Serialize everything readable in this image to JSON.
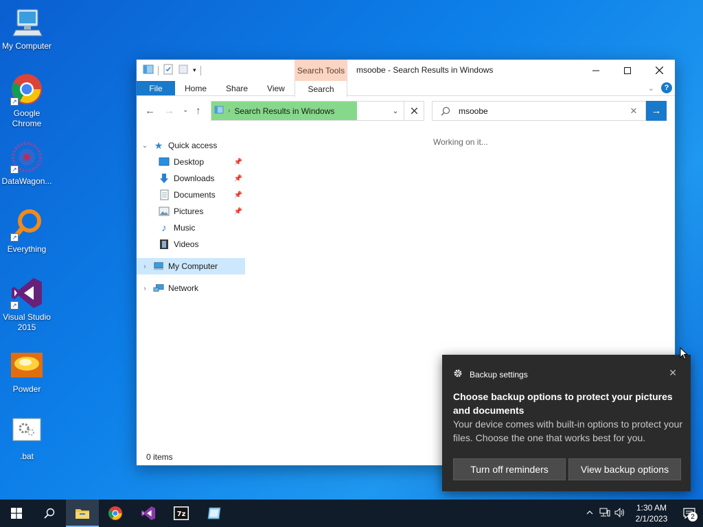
{
  "desktop": {
    "icons": [
      {
        "label": "My Computer"
      },
      {
        "label": "Google Chrome"
      },
      {
        "label": "DataWagon..."
      },
      {
        "label": "Everything"
      },
      {
        "label": "Visual Studio 2015"
      },
      {
        "label": "Powder"
      },
      {
        "label": ".bat"
      }
    ]
  },
  "explorer": {
    "context_tab_group": "Search Tools",
    "title": "msoobe - Search Results in Windows",
    "ribbon_tabs": [
      "File",
      "Home",
      "Share",
      "View"
    ],
    "context_tab": "Search",
    "address": "Search Results in Windows",
    "search_value": "msoobe",
    "status_message": "Working on it...",
    "item_count": "0 items",
    "nav": {
      "quick_access": "Quick access",
      "items": [
        "Desktop",
        "Downloads",
        "Documents",
        "Pictures",
        "Music",
        "Videos"
      ],
      "my_computer": "My Computer",
      "network": "Network"
    }
  },
  "toast": {
    "app": "Backup settings",
    "title": "Choose backup options to protect your pictures and documents",
    "body": "Your device comes with built-in options to protect your files. Choose the one that works best for you.",
    "btn_off": "Turn off reminders",
    "btn_view": "View backup options"
  },
  "taskbar": {
    "time": "1:30 AM",
    "date": "2/1/2023",
    "notification_count": "2"
  },
  "colors": {
    "accent": "#1979ca",
    "address_fill": "#86d98a",
    "toast_bg": "#2b2b2b",
    "taskbar_bg": "#101c2a"
  }
}
